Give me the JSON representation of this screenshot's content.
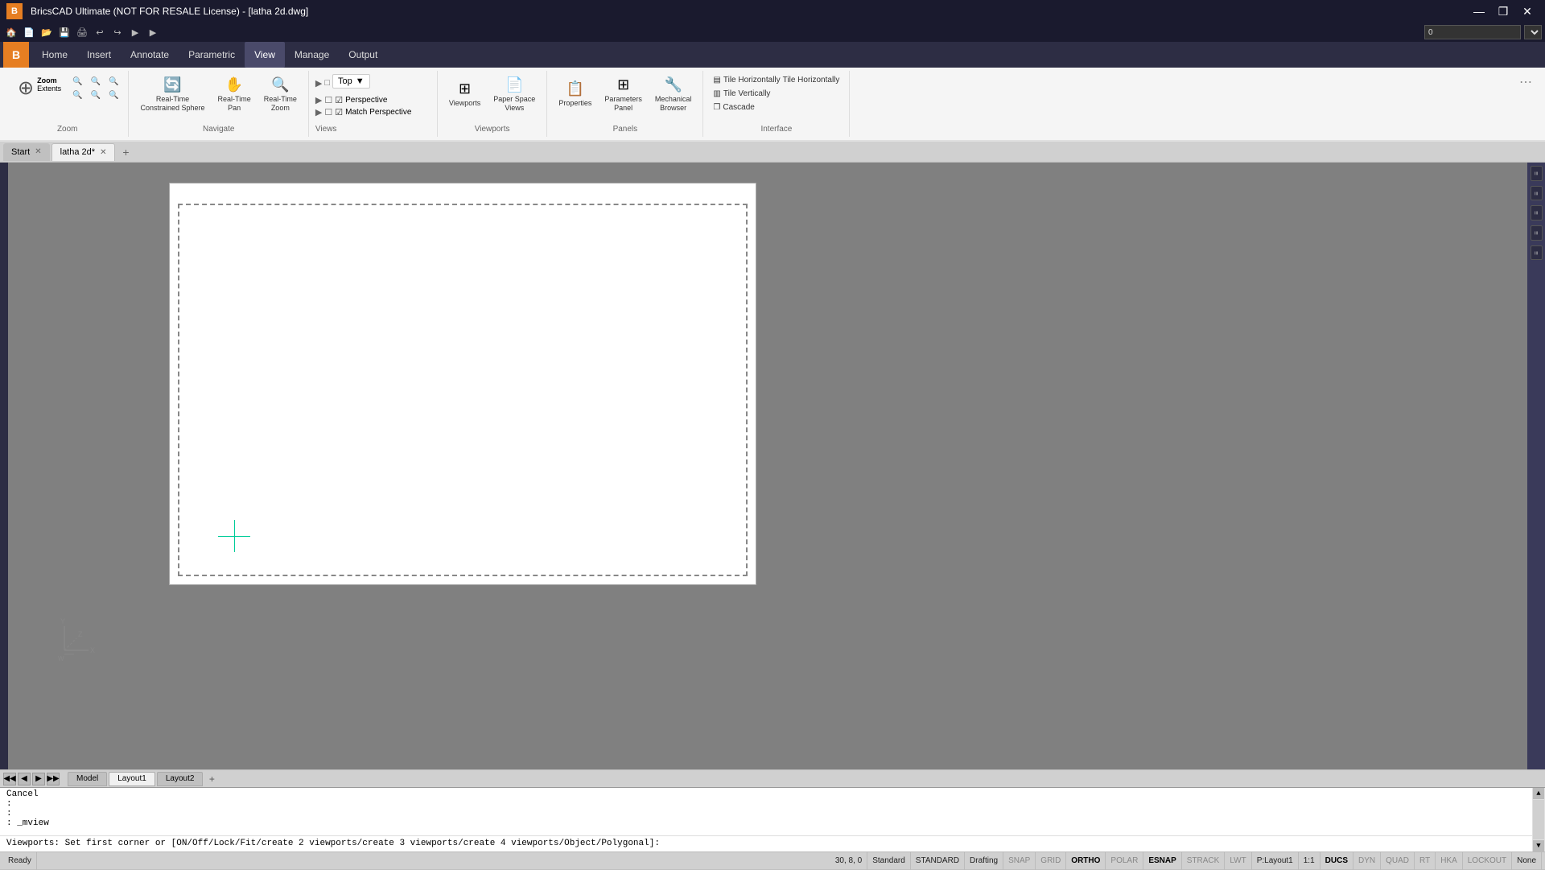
{
  "titlebar": {
    "title": "BricsCAD Ultimate (NOT FOR RESALE License) - [latha 2d.dwg]",
    "minimize": "—",
    "restore": "❐",
    "close": "✕"
  },
  "quickaccess": {
    "buttons": [
      "🏠",
      "📄",
      "📂",
      "💾",
      "⎌",
      "⎌",
      "▶",
      "▶"
    ]
  },
  "menubar": {
    "logo": "B",
    "items": [
      "Home",
      "Insert",
      "Annotate",
      "Parametric",
      "View",
      "Manage",
      "Output"
    ]
  },
  "ribbon": {
    "active_tab": "View",
    "tabs": [
      "Home",
      "Insert",
      "Annotate",
      "Parametric",
      "View",
      "Manage",
      "Output"
    ],
    "groups": {
      "zoom": {
        "label": "Zoom",
        "buttons": [
          {
            "label": "Zoom\nExtents",
            "icon": "⊕"
          },
          {
            "label": "",
            "icon": "🔍"
          },
          {
            "label": "",
            "icon": "🔍"
          },
          {
            "label": "",
            "icon": "🔍"
          },
          {
            "label": "",
            "icon": "🔍"
          },
          {
            "label": "",
            "icon": "🔍"
          },
          {
            "label": "",
            "icon": "🔍"
          }
        ]
      },
      "navigate": {
        "label": "Navigate",
        "buttons": [
          {
            "label": "Real-Time\nConstrained Sphere",
            "icon": "🔄"
          },
          {
            "label": "Real-Time\nPan",
            "icon": "✋"
          },
          {
            "label": "Real-Time\nZoom",
            "icon": "🔍"
          }
        ]
      },
      "views": {
        "label": "Views",
        "dropdown": "Top",
        "sub1_icon": "□",
        "sub1_label": "Perspective",
        "sub2_icon": "□",
        "sub2_label": "Match Perspective",
        "checkboxes": [
          "□",
          "■",
          "■",
          "■",
          "■"
        ]
      },
      "viewports": {
        "label": "Viewports",
        "buttons": [
          {
            "label": "Viewports",
            "icon": "⊞"
          },
          {
            "label": "Paper Space\nViews",
            "icon": "📄"
          }
        ]
      },
      "panels": {
        "label": "Panels",
        "buttons": [
          {
            "label": "Properties",
            "icon": "📋"
          },
          {
            "label": "Parameters\nPanel",
            "icon": "⊞"
          },
          {
            "label": "Mechanical\nBrowser",
            "icon": "🔧"
          }
        ]
      },
      "interface": {
        "label": "Interface",
        "buttons": [
          {
            "label": "Tile Horizontally",
            "icon": ""
          },
          {
            "label": "Tile Vertically",
            "icon": ""
          },
          {
            "label": "Cascade",
            "icon": ""
          }
        ]
      }
    }
  },
  "doctabs": {
    "tabs": [
      {
        "label": "Start",
        "closable": false
      },
      {
        "label": "latha 2d*",
        "closable": true,
        "active": true
      }
    ],
    "add_label": "+"
  },
  "canvas": {
    "background": "#808080",
    "paper_bg": "#ffffff"
  },
  "layout_tabs": {
    "nav_buttons": [
      "◀◀",
      "◀",
      "▶",
      "▶▶"
    ],
    "tabs": [
      {
        "label": "Model",
        "active": false
      },
      {
        "label": "Layout1",
        "active": true
      },
      {
        "label": "Layout2",
        "active": false
      }
    ],
    "add": "+"
  },
  "command": {
    "lines": [
      "Cancel",
      ":",
      ":",
      ": _mview"
    ],
    "prompt": "Viewports:  Set first corner or [ON/Off/Lock/Fit/create 2 viewports/create 3 viewports/create 4 viewports/Object/Polygonal]:"
  },
  "statusbar": {
    "coord": "30, 8, 0",
    "items": [
      {
        "label": "Standard",
        "active": false
      },
      {
        "label": "STANDARD",
        "active": false
      },
      {
        "label": "Drafting",
        "active": false
      },
      {
        "label": "SNAP",
        "active": false
      },
      {
        "label": "GRID",
        "active": false
      },
      {
        "label": "ORTHO",
        "active": true
      },
      {
        "label": "POLAR",
        "active": false
      },
      {
        "label": "ESNAP",
        "active": true
      },
      {
        "label": "STRACK",
        "active": false
      },
      {
        "label": "LWT",
        "active": false
      },
      {
        "label": "P:Layout1",
        "active": false
      },
      {
        "label": "1:1",
        "active": false
      },
      {
        "label": "DUCS",
        "active": true
      },
      {
        "label": "DYN",
        "active": false
      },
      {
        "label": "QUAD",
        "active": false
      },
      {
        "label": "RT",
        "active": false
      },
      {
        "label": "HKA",
        "active": false
      },
      {
        "label": "LOCKOUT",
        "active": false
      },
      {
        "label": "None",
        "active": false
      }
    ],
    "ready": "Ready"
  },
  "right_panel": {
    "buttons": [
      "≡",
      "≡",
      "≡",
      "≡",
      "≡"
    ]
  }
}
